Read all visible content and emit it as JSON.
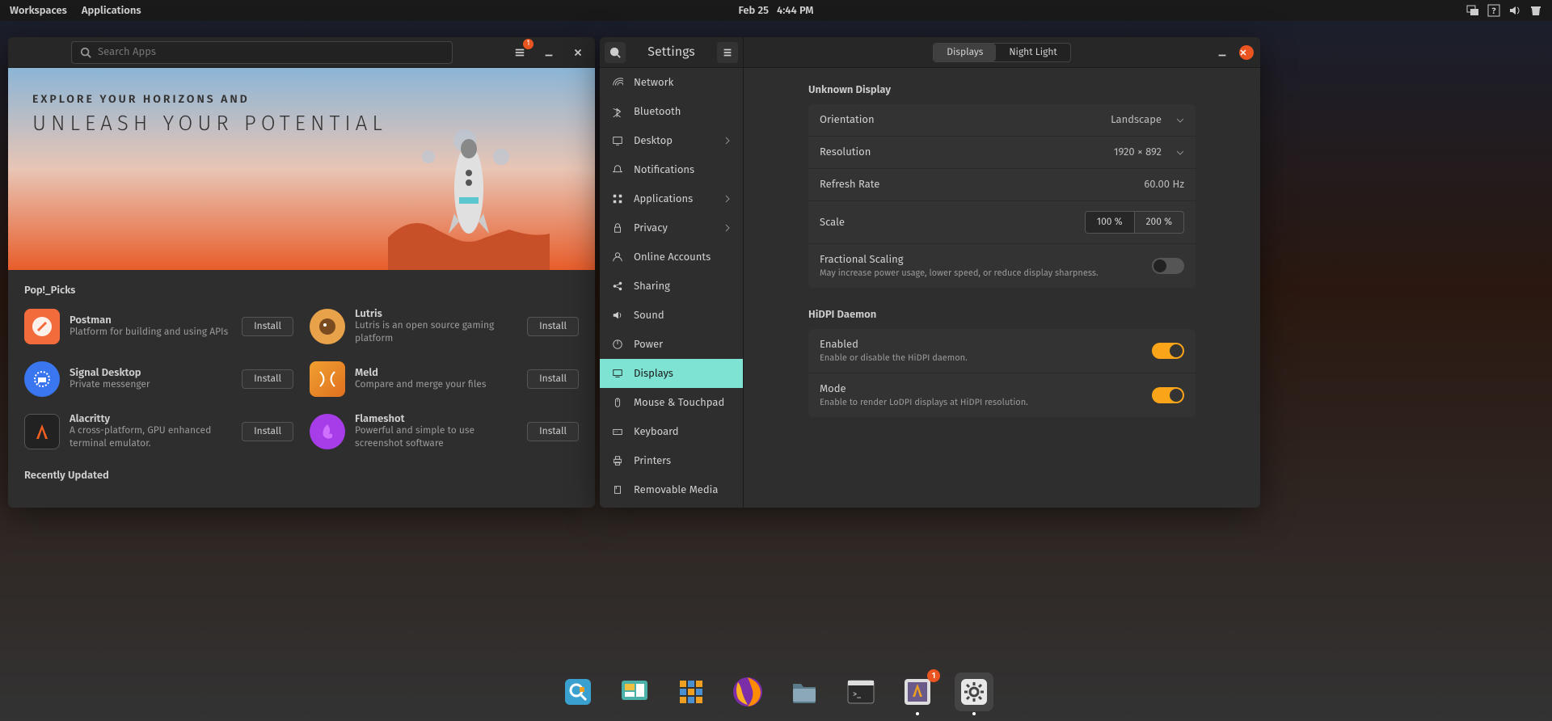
{
  "topbar": {
    "workspaces": "Workspaces",
    "applications": "Applications",
    "date": "Feb 25",
    "time": "4:44 PM"
  },
  "popshop": {
    "search_placeholder": "Search Apps",
    "updates_badge": "1",
    "banner_sub": "EXPLORE YOUR HORIZONS AND",
    "banner_main": "UNLEASH YOUR POTENTIAL",
    "picks_title": "Pop!_Picks",
    "install_label": "Install",
    "recently_updated": "Recently Updated",
    "apps": [
      {
        "name": "Postman",
        "desc": "Platform for building and using APIs",
        "bg": "#f26b3a"
      },
      {
        "name": "Lutris",
        "desc": "Lutris is an open source gaming platform",
        "bg": "#e8a24a"
      },
      {
        "name": "Signal Desktop",
        "desc": "Private messenger",
        "bg": "#3a76f0"
      },
      {
        "name": "Meld",
        "desc": "Compare and merge your files",
        "bg": "#e08030"
      },
      {
        "name": "Alacritty",
        "desc": "A cross-platform, GPU enhanced terminal emulator.",
        "bg": "#222"
      },
      {
        "name": "Flameshot",
        "desc": "Powerful and simple to use screenshot software",
        "bg": "#a63de8"
      }
    ]
  },
  "settings": {
    "title": "Settings",
    "tabs": {
      "displays": "Displays",
      "night": "Night Light"
    },
    "sidebar": [
      {
        "label": "Network",
        "icon": "network"
      },
      {
        "label": "Bluetooth",
        "icon": "bluetooth"
      },
      {
        "label": "Desktop",
        "icon": "desktop",
        "chev": true
      },
      {
        "label": "Notifications",
        "icon": "bell"
      },
      {
        "label": "Applications",
        "icon": "apps",
        "chev": true
      },
      {
        "label": "Privacy",
        "icon": "lock",
        "chev": true
      },
      {
        "label": "Online Accounts",
        "icon": "user"
      },
      {
        "label": "Sharing",
        "icon": "share"
      },
      {
        "label": "Sound",
        "icon": "sound"
      },
      {
        "label": "Power",
        "icon": "power"
      },
      {
        "label": "Displays",
        "icon": "display",
        "active": true
      },
      {
        "label": "Mouse & Touchpad",
        "icon": "mouse"
      },
      {
        "label": "Keyboard",
        "icon": "keyboard"
      },
      {
        "label": "Printers",
        "icon": "printer"
      },
      {
        "label": "Removable Media",
        "icon": "media"
      }
    ],
    "content": {
      "unknown_display": "Unknown Display",
      "orientation_label": "Orientation",
      "orientation_value": "Landscape",
      "resolution_label": "Resolution",
      "resolution_value": "1920 × 892",
      "refresh_label": "Refresh Rate",
      "refresh_value": "60.00 Hz",
      "scale_label": "Scale",
      "scale_100": "100 %",
      "scale_200": "200 %",
      "fractional_label": "Fractional Scaling",
      "fractional_sub": "May increase power usage, lower speed, or reduce display sharpness.",
      "hidpi_title": "HiDPI Daemon",
      "enabled_label": "Enabled",
      "enabled_sub": "Enable or disable the HiDPI daemon.",
      "mode_label": "Mode",
      "mode_sub": "Enable to render LoDPI displays at HiDPI resolution."
    }
  },
  "dock": {
    "badge": "1"
  }
}
